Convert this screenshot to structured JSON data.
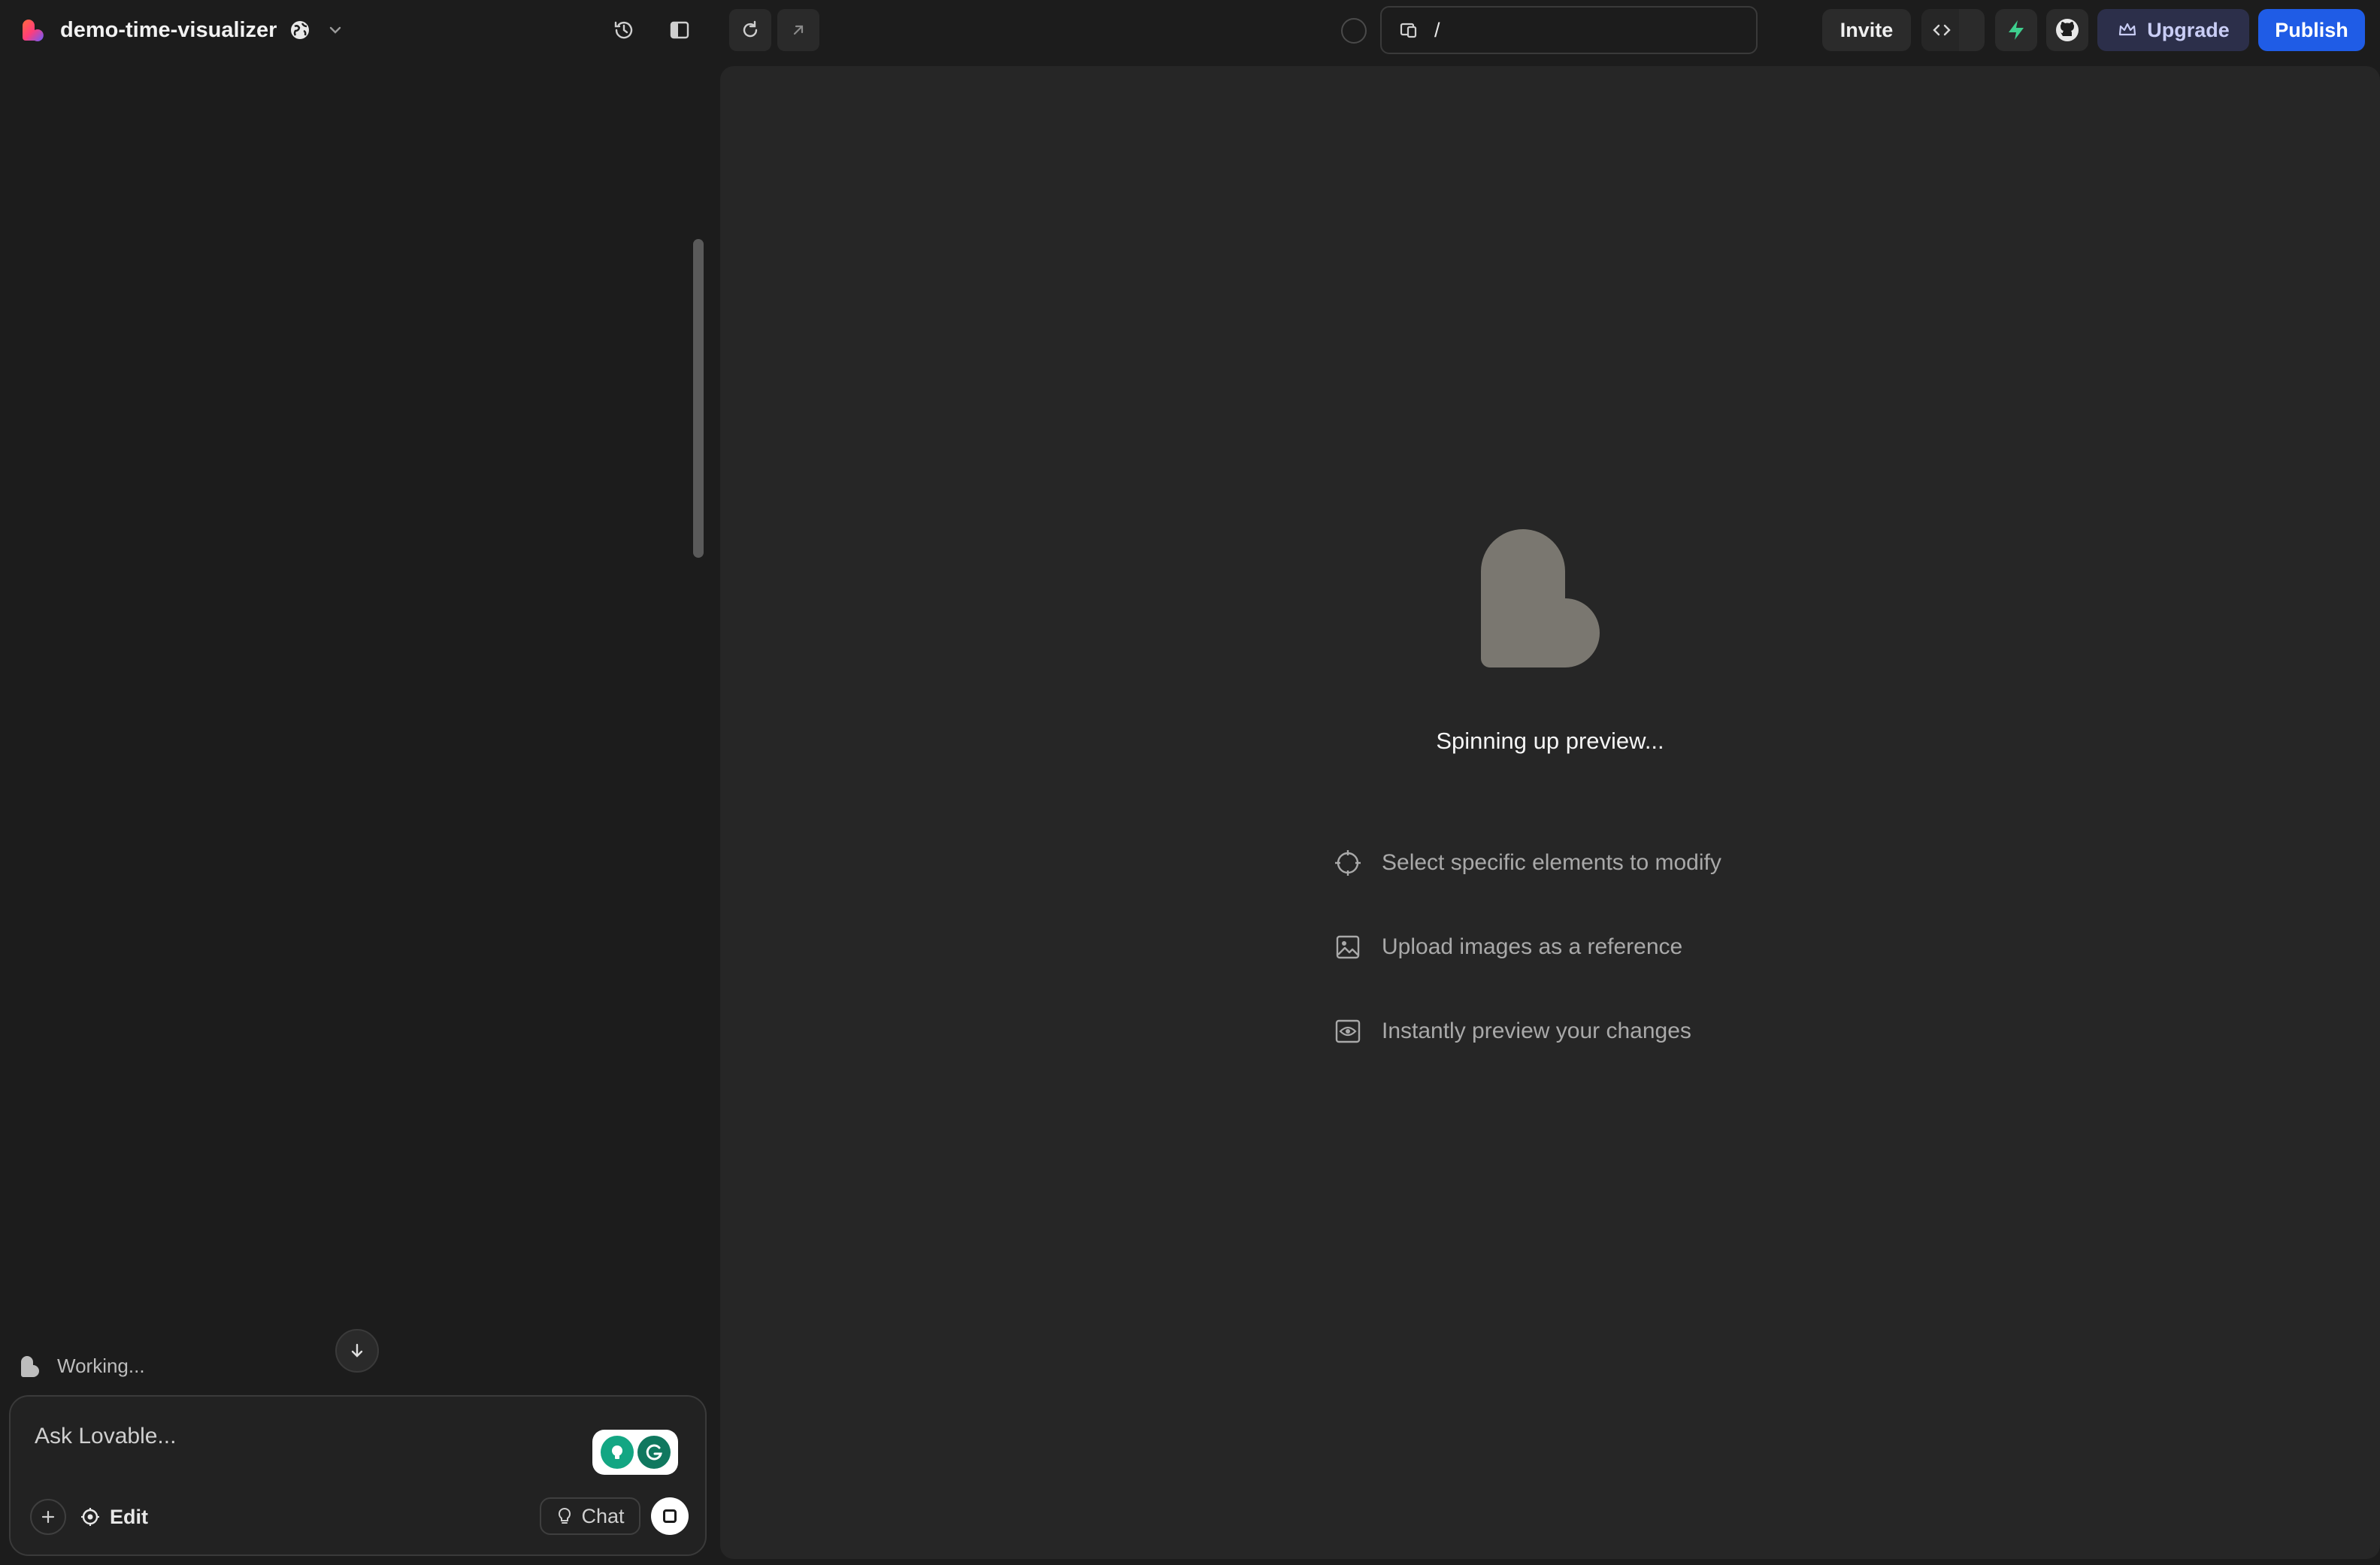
{
  "header": {
    "project_name": "demo-time-visualizer",
    "url_path": "/",
    "invite_label": "Invite",
    "upgrade_label": "Upgrade",
    "publish_label": "Publish",
    "accent_color": "#1f5ce6"
  },
  "chat": {
    "status_text": "Working...",
    "input_placeholder": "Ask Lovable...",
    "edit_label": "Edit",
    "chat_label": "Chat"
  },
  "preview": {
    "loading_text": "Spinning up preview...",
    "tips": [
      {
        "icon": "crosshair-icon",
        "text": "Select specific elements to modify"
      },
      {
        "icon": "image-icon",
        "text": "Upload images as a reference"
      },
      {
        "icon": "eye-icon",
        "text": "Instantly preview your changes"
      }
    ]
  }
}
